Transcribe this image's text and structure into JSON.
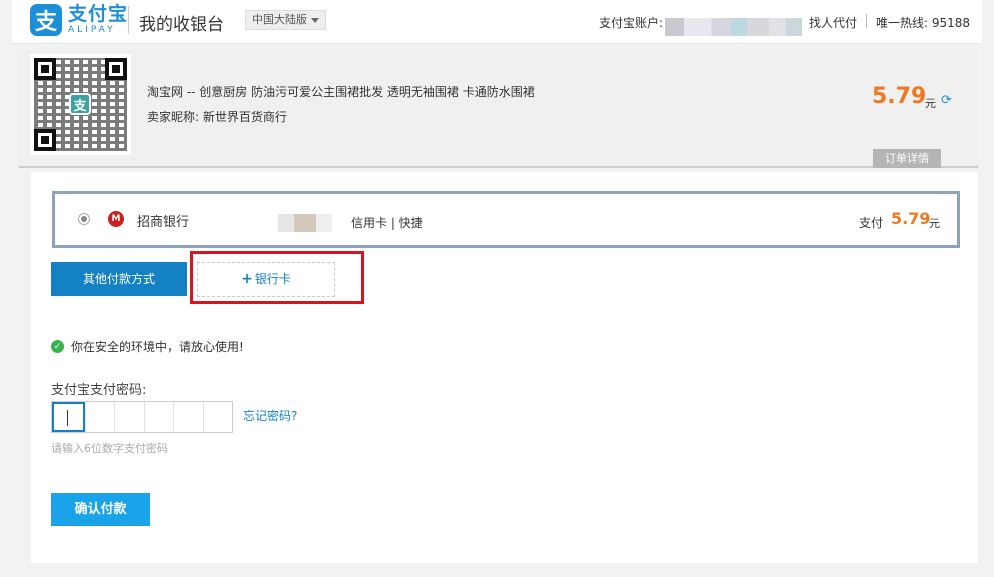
{
  "header": {
    "logo_cn": "支付宝",
    "logo_en": "ALIPAY",
    "logo_glyph": "支",
    "title": "我的收银台",
    "region": "中国大陆版",
    "account_label": "支付宝账户:",
    "find_proxy": "找人代付",
    "hotline": "唯一热线: 95188"
  },
  "order": {
    "qr_center_glyph": "支",
    "product": "淘宝网 -- 创意厨房 防油污可爱公主围裙批发 透明无袖围裙 卡通防水围裙",
    "seller": "卖家昵称: 新世界百货商行",
    "price": "5.79",
    "price_unit": "元",
    "details_tab": "订单详情"
  },
  "payment": {
    "bank_name": "招商银行",
    "bank_icon_glyph": "M",
    "card_type": "信用卡 | 快捷",
    "pay_label": "支付",
    "pay_amount": "5.79",
    "pay_unit": "元",
    "other_methods": "其他付款方式",
    "add_card_plus": "+",
    "add_card": "银行卡",
    "secure_notice": "你在安全的环境中，请放心使用!",
    "password_label": "支付宝支付密码:",
    "forgot_password": "忘记密码?",
    "password_hint": "请输入6位数字支付密码",
    "confirm": "确认付款"
  },
  "colors": {
    "brand_blue": "#1e8fd6",
    "price_orange": "#f07820",
    "highlight_red": "#d9141e",
    "success_green": "#37b24d"
  },
  "icons": [
    "alipay-logo-icon",
    "chevron-down-icon",
    "qr-code-icon",
    "refresh-icon",
    "radio-icon",
    "cmb-bank-icon",
    "plus-icon",
    "check-circle-icon"
  ]
}
